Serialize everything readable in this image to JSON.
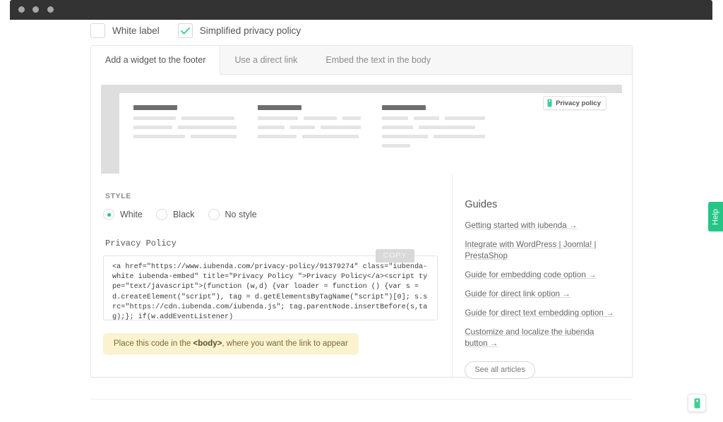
{
  "window": {
    "dots": [
      "dot-1",
      "dot-2",
      "dot-3"
    ]
  },
  "options": {
    "white_label": {
      "label": "White label",
      "checked": false
    },
    "simplified": {
      "label": "Simplified privacy policy",
      "checked": true,
      "check_icon": "check-icon"
    }
  },
  "tabs": [
    {
      "label": "Add a widget to the footer",
      "active": true
    },
    {
      "label": "Use a direct link",
      "active": false
    },
    {
      "label": "Embed the text in the body",
      "active": false
    }
  ],
  "preview": {
    "badge": {
      "label": "Privacy policy",
      "icon": "shield-icon"
    },
    "columns": [
      {
        "lines": [
          [
            60,
            75
          ],
          [
            72,
            110
          ],
          [
            90,
            80
          ]
        ]
      },
      {
        "lines": [
          [
            60,
            50,
            28
          ],
          [
            40,
            36,
            60
          ],
          [
            55,
            80
          ]
        ]
      },
      {
        "lines": [
          [
            40,
            40,
            62
          ],
          [
            44,
            80
          ],
          [
            65,
            73
          ],
          [
            40
          ]
        ]
      }
    ]
  },
  "style": {
    "title": "Style",
    "options": [
      {
        "label": "White",
        "selected": true
      },
      {
        "label": "Black",
        "selected": false
      },
      {
        "label": "No style",
        "selected": false
      }
    ]
  },
  "code": {
    "title": "Privacy Policy",
    "copy_label": "COPY",
    "snippet": "<a href=\"https://www.iubenda.com/privacy-policy/91379274\" class=\"iubenda-white iubenda-embed\" title=\"Privacy Policy \">Privacy Policy</a><script type=\"text/javascript\">(function (w,d) {var loader = function () {var s = d.createElement(\"script\"), tag = d.getElementsByTagName(\"script\")[0]; s.src=\"https://cdn.iubenda.com/iubenda.js\"; tag.parentNode.insertBefore(s,tag);}; if(w.addEventListener)"
  },
  "notice": {
    "prefix": "Place this code in the ",
    "code": "<body>",
    "suffix": ", where you want the link to appear"
  },
  "guides": {
    "title": "Guides",
    "links": [
      "Getting started with iubenda  →",
      "Integrate with WordPress | Joomla! | PrestaShop",
      "Guide for embedding code option  →",
      "Guide for direct link option  →",
      "Guide for direct text embedding option  →",
      "Customize and localize the iubenda button  →"
    ],
    "see_all_label": "See all articles"
  },
  "help_tab": {
    "label": "Help"
  },
  "float_button": {
    "icon": "shield-icon"
  },
  "colors": {
    "accent_green": "#25c685",
    "titlebar": "#333333",
    "notice_bg": "#fbf2d0",
    "preview_bg": "#dedede"
  }
}
